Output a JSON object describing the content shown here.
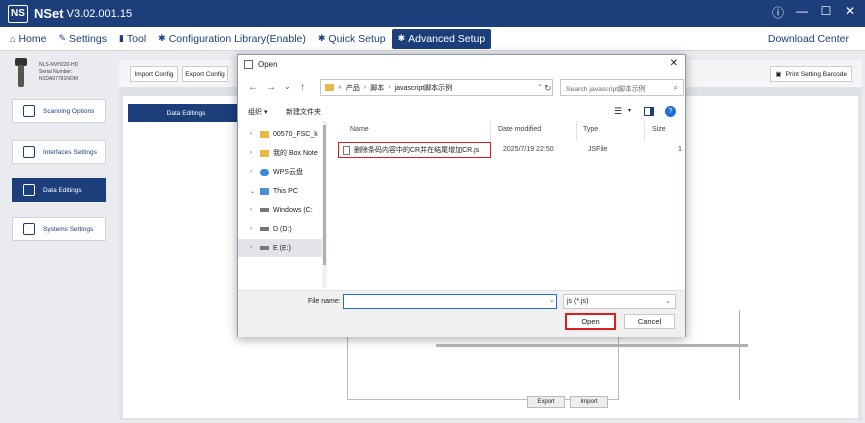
{
  "app": {
    "logo": "NS",
    "name": "NSet",
    "version": "V3.02.001.15"
  },
  "window_controls": {
    "info": "ⓘ",
    "minimize": "—",
    "maximize": "☐",
    "close": "✕"
  },
  "menu": {
    "items": [
      {
        "icon": "home-icon",
        "label": "Home"
      },
      {
        "icon": "wrench-icon",
        "label": "Settings"
      },
      {
        "icon": "tool-icon",
        "label": "Tool"
      },
      {
        "icon": "gear-icon",
        "label": "Configuration Library(Enable)"
      },
      {
        "icon": "gear-icon",
        "label": "Quick Setup"
      },
      {
        "icon": "gear-icon",
        "label": "Advanced Setup"
      }
    ],
    "active_index": 5,
    "download_center": "Download Center"
  },
  "device": {
    "model": "NLS-NVH220-HD",
    "serial_label": "Serial Number:",
    "serial": "N1DA07781NOM"
  },
  "sidebar": {
    "items": [
      {
        "label": "Scanning Options"
      },
      {
        "label": "Interfaces Settings"
      },
      {
        "label": "Data Editings"
      },
      {
        "label": "Systems Settings"
      }
    ],
    "active_index": 2
  },
  "toolbar": {
    "import_config": "Import Config",
    "export_config": "Export Config",
    "print_barcode": "Print Setting Barcode"
  },
  "main_panel": {
    "tab": "Data Editings",
    "export": "Export",
    "import": "Import"
  },
  "dialog": {
    "title": "Open",
    "breadcrumb": [
      "产品",
      "脚本",
      "javascript脚本示例"
    ],
    "search_placeholder": "Search javascript脚本示例",
    "organize": "组织 ▾",
    "new_folder": "新建文件夹",
    "tree": [
      {
        "label": "00570_FSC_k",
        "icon": "folder",
        "arrow": "›"
      },
      {
        "label": "我的 Box Note",
        "icon": "folder",
        "arrow": "›"
      },
      {
        "label": "WPS云盘",
        "icon": "cloud",
        "arrow": "›"
      },
      {
        "label": "This PC",
        "icon": "pc",
        "arrow": "⌄"
      },
      {
        "label": "Windows (C:",
        "icon": "drive",
        "arrow": "›"
      },
      {
        "label": "D (D:)",
        "icon": "drive",
        "arrow": "›"
      },
      {
        "label": "E (E:)",
        "icon": "drive",
        "arrow": "›"
      }
    ],
    "tree_selected_index": 6,
    "columns": {
      "name": "Name",
      "date": "Date modified",
      "type": "Type",
      "size": "Size"
    },
    "files": [
      {
        "name": "删除条码内容中的CR并在结尾增加CR.js",
        "date": "2025/7/19 22:50",
        "type": "JSFile",
        "size": "1"
      }
    ],
    "file_name_label": "File name:",
    "file_name_value": "",
    "file_type": "js (*.js)",
    "open_button": "Open",
    "cancel_button": "Cancel"
  }
}
